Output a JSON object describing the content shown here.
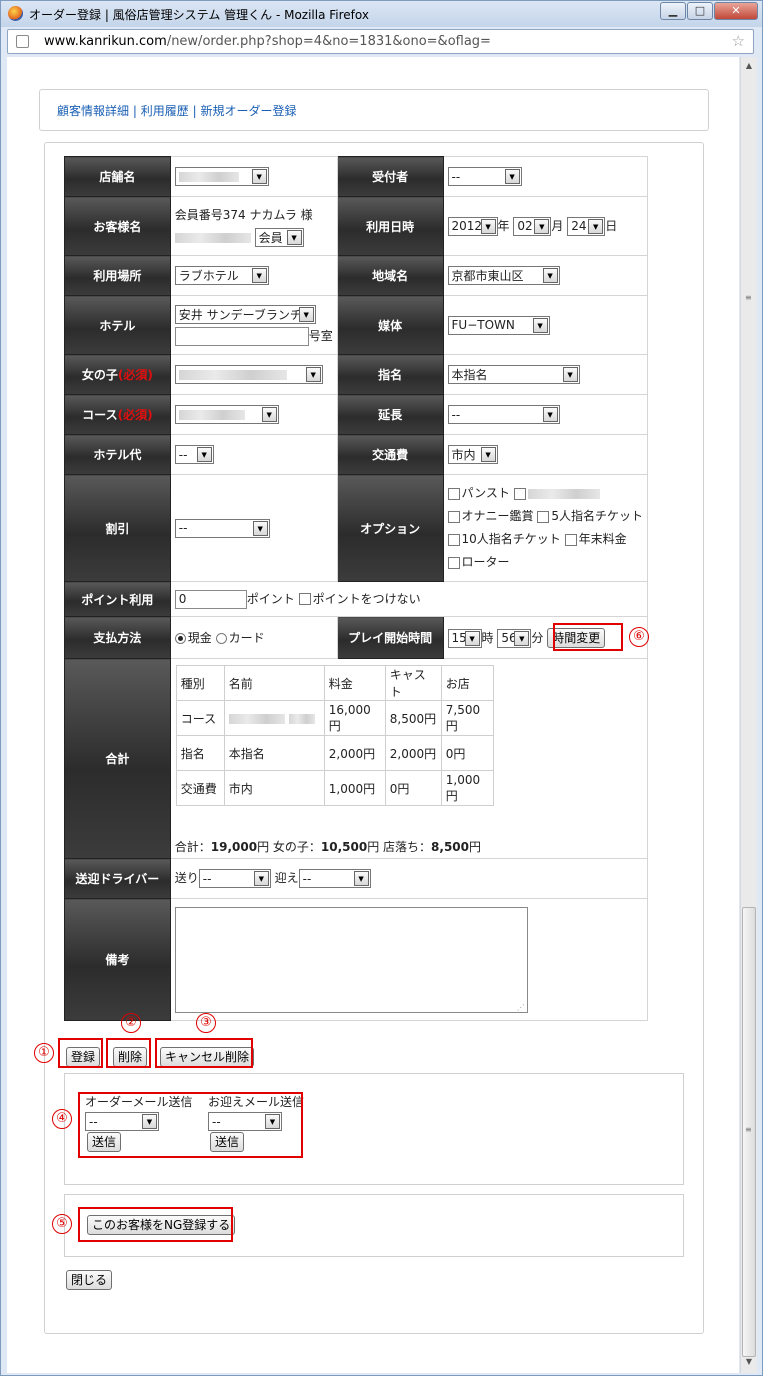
{
  "window": {
    "title": "オーダー登録 | 風俗店管理システム 管理くん - Mozilla Firefox",
    "url_host": "www.kanrikun.com",
    "url_path": "/new/order.php?shop=4&no=1831&ono=&oflag=",
    "min_icon": "minimize-icon",
    "max_icon": "maximize-icon",
    "close_icon": "close-icon"
  },
  "nav": {
    "links": [
      "顧客情報詳細",
      "利用履歴",
      "新規オーダー登録"
    ],
    "separator": "|"
  },
  "form": {
    "shop_label": "店舗名",
    "receptionist_label": "受付者",
    "receptionist_value": "--",
    "customer_label": "お客様名",
    "customer_info": "会員番号374 ナカムラ 様",
    "member_value": "会員",
    "datetime_label": "利用日時",
    "year_value": "2012",
    "year_unit": "年",
    "month_value": "02",
    "month_unit": "月",
    "day_value": "24",
    "day_unit": "日",
    "place_label": "利用場所",
    "place_value": "ラブホテル",
    "area_label": "地域名",
    "area_value": "京都市東山区",
    "hotel_label": "ホテル",
    "hotel_value": "安井 サンデーブランチ",
    "room_unit": "号室",
    "media_label": "媒体",
    "media_value": "FU−TOWN",
    "girl_label": "女の子",
    "required_mark": "(必須)",
    "nomination_label": "指名",
    "nomination_value": "本指名",
    "course_label": "コース",
    "extension_label": "延長",
    "extension_value": "--",
    "hotel_fee_label": "ホテル代",
    "hotel_fee_value": "--",
    "transport_label": "交通費",
    "transport_value": "市内",
    "discount_label": "割引",
    "discount_value": "--",
    "option_label": "オプション",
    "options": [
      "パンスト",
      "オナニー鑑賞",
      "5人指名チケット",
      "10人指名チケット",
      "年末料金",
      "ローター"
    ],
    "point_label": "ポイント利用",
    "point_value": "0",
    "point_unit": "ポイント",
    "point_none_label": "ポイントをつけない",
    "payment_label": "支払方法",
    "payment_cash": "現金",
    "payment_card": "カード",
    "play_start_label": "プレイ開始時間",
    "hour_value": "15",
    "hour_unit": "時",
    "minute_value": "56",
    "minute_unit": "分",
    "time_change_button": "時間変更",
    "total_label": "合計",
    "summary_headers": [
      "種別",
      "名前",
      "料金",
      "キャスト",
      "お店"
    ],
    "summary_rows": [
      [
        "コース",
        "",
        "16,000円",
        "8,500円",
        "7,500円"
      ],
      [
        "指名",
        "本指名",
        "2,000円",
        "2,000円",
        "0円"
      ],
      [
        "交通費",
        "市内",
        "1,000円",
        "0円",
        "1,000円"
      ]
    ],
    "total_prefix": "合計：",
    "total_value": "19,000",
    "girl_total_prefix": "円 女の子：",
    "girl_total_value": "10,500",
    "shop_total_prefix": "円 店落ち：",
    "shop_total_value": "8,500",
    "yen": "円",
    "driver_label": "送迎ドライバー",
    "send_label": "送り",
    "send_value": "--",
    "pickup_label": "迎え",
    "pickup_value": "--",
    "notes_label": "備考"
  },
  "actions": {
    "register_button": "登録",
    "delete_button": "削除",
    "cancel_delete_button": "キャンセル削除",
    "order_mail_label": "オーダーメール送信",
    "order_mail_value": "--",
    "pickup_mail_label": "お迎えメール送信",
    "pickup_mail_value": "--",
    "send_button": "送信",
    "ng_button": "このお客様をNG登録する",
    "close_button": "閉じる"
  },
  "annotations": [
    "①",
    "②",
    "③",
    "④",
    "⑤",
    "⑥"
  ],
  "colors": {
    "annotation": "#e00000",
    "link": "#1a5fb4",
    "header_bg": "#3c3c3c",
    "required": "#e01010"
  }
}
